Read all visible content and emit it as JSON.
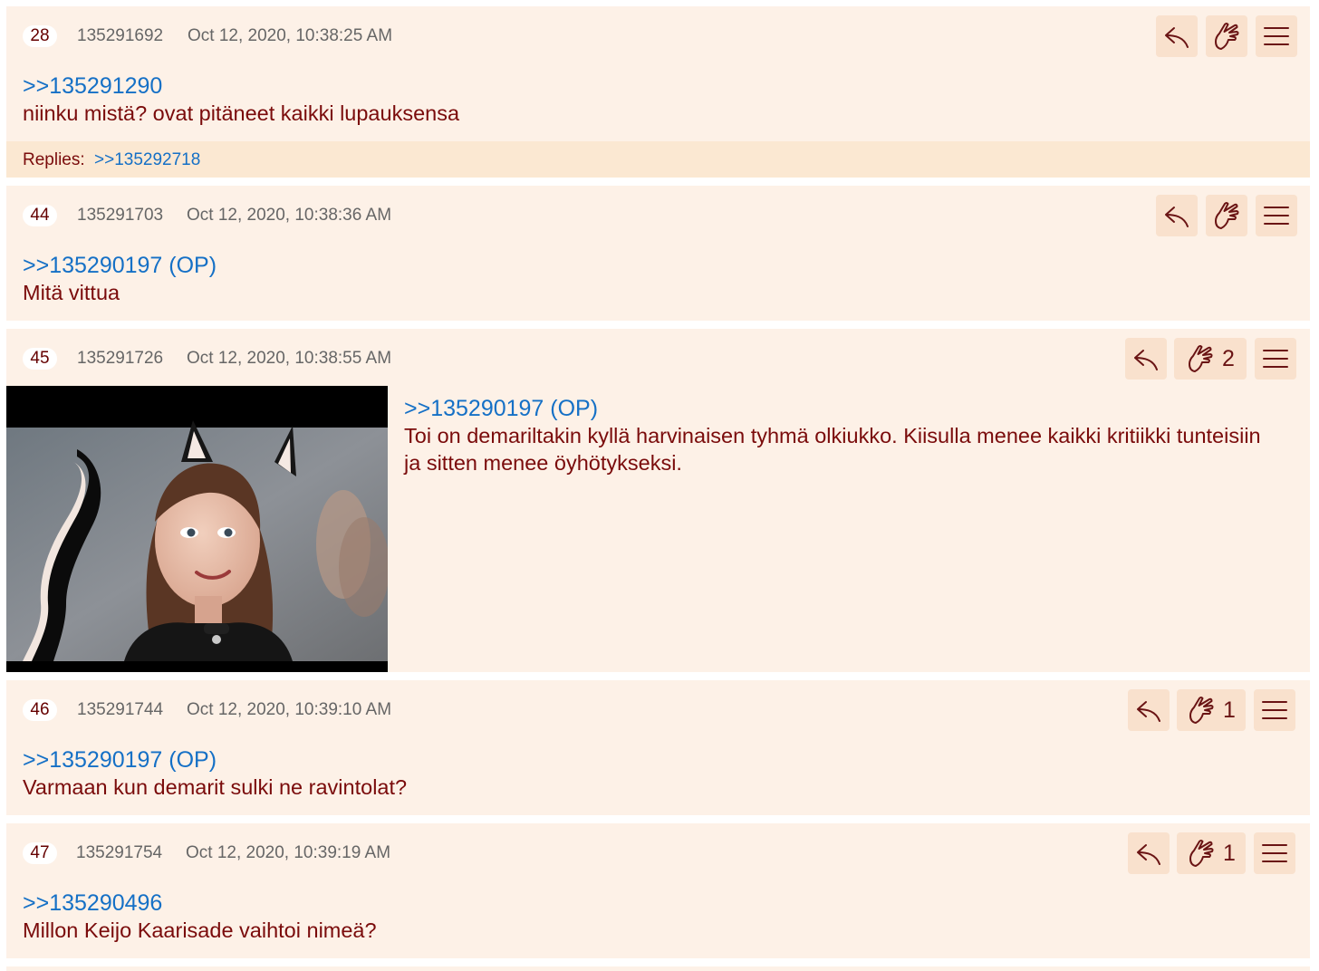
{
  "thread": {
    "colors": {
      "post_bg": "#fdf1e7",
      "replies_bg": "#fbe8d2",
      "text": "#7a0b0b",
      "link": "#1570c6",
      "meta": "#666666",
      "button_bg": "#f9e1cd"
    },
    "icons": {
      "reply": "reply-arrow-icon",
      "react": "hand-pointer-icon",
      "menu": "hamburger-menu-icon"
    },
    "posts": [
      {
        "num": "28",
        "id": "135291692",
        "date": "Oct 12, 2020, 10:38:25 AM",
        "reactions": "",
        "quote": ">>135291290",
        "text": "niinku mistä? ovat pitäneet kaikki lupauksensa",
        "replies_label": "Replies:",
        "replies": ">>135292718"
      },
      {
        "num": "44",
        "id": "135291703",
        "date": "Oct 12, 2020, 10:38:36 AM",
        "reactions": "",
        "quote": ">>135290197 (OP)",
        "text": "Mitä vittua"
      },
      {
        "num": "45",
        "id": "135291726",
        "date": "Oct 12, 2020, 10:38:55 AM",
        "reactions": "2",
        "quote": ">>135290197 (OP)",
        "text": "Toi on demariltakin kyllä harvinaisen tyhmä olkiukko. Kiisulla menee kaikki kritiikki tunteisiin ja sitten menee öyhötykseksi."
      },
      {
        "num": "46",
        "id": "135291744",
        "date": "Oct 12, 2020, 10:39:10 AM",
        "reactions": "1",
        "quote": ">>135290197 (OP)",
        "text": "Varmaan kun demarit sulki ne ravintolat?"
      },
      {
        "num": "47",
        "id": "135291754",
        "date": "Oct 12, 2020, 10:39:19 AM",
        "reactions": "1",
        "quote": ">>135290496",
        "text": "Millon Keijo Kaarisade vaihtoi nimeä?"
      }
    ]
  }
}
